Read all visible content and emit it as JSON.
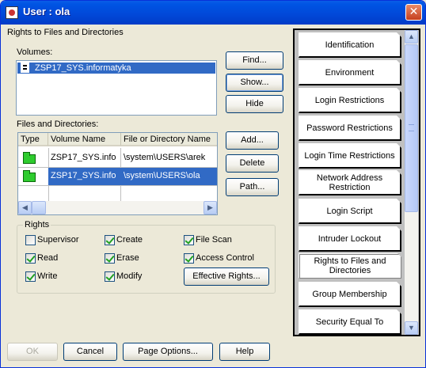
{
  "window": {
    "title": "User : ola"
  },
  "rights_section": {
    "title": "Rights to Files and Directories"
  },
  "volumes": {
    "label": "Volumes:",
    "items": [
      "ZSP17_SYS.informatyka"
    ]
  },
  "volume_buttons": {
    "find": "Find...",
    "show": "Show...",
    "hide": "Hide"
  },
  "files": {
    "label": "Files and Directories:",
    "columns": [
      "Type",
      "Volume Name",
      "File or Directory Name"
    ],
    "rows": [
      {
        "volume": "ZSP17_SYS.info",
        "path": "\\system\\USERS\\arek"
      },
      {
        "volume": "ZSP17_SYS.info",
        "path": "\\system\\USERS\\ola"
      }
    ]
  },
  "file_buttons": {
    "add": "Add...",
    "delete": "Delete",
    "path": "Path..."
  },
  "rights": {
    "label": "Rights",
    "items": [
      {
        "label": "Supervisor",
        "checked": false
      },
      {
        "label": "Create",
        "checked": true
      },
      {
        "label": "File Scan",
        "checked": true
      },
      {
        "label": "Read",
        "checked": true
      },
      {
        "label": "Erase",
        "checked": true
      },
      {
        "label": "Access Control",
        "checked": true
      },
      {
        "label": "Write",
        "checked": true
      },
      {
        "label": "Modify",
        "checked": true
      }
    ],
    "effective_button": "Effective Rights..."
  },
  "pages": [
    {
      "label": "Identification",
      "active": false
    },
    {
      "label": "Environment",
      "active": false
    },
    {
      "label": "Login Restrictions",
      "active": false
    },
    {
      "label": "Password Restrictions",
      "active": false
    },
    {
      "label": "Login Time Restrictions",
      "active": false
    },
    {
      "label": "Network Address Restriction",
      "active": false
    },
    {
      "label": "Login Script",
      "active": false
    },
    {
      "label": "Intruder Lockout",
      "active": false
    },
    {
      "label": "Rights to Files and Directories",
      "active": true
    },
    {
      "label": "Group Membership",
      "active": false
    },
    {
      "label": "Security Equal To",
      "active": false
    }
  ],
  "footer": {
    "ok": "OK",
    "cancel": "Cancel",
    "page_options": "Page Options...",
    "help": "Help"
  },
  "icons": {
    "title": "netware-user-icon",
    "volume": "disk-icon",
    "folder": "folder-icon",
    "close": "close-icon"
  },
  "colors": {
    "selection": "#316ac5",
    "folder": "#2ecc2e",
    "titlebar": "#0054e3"
  }
}
